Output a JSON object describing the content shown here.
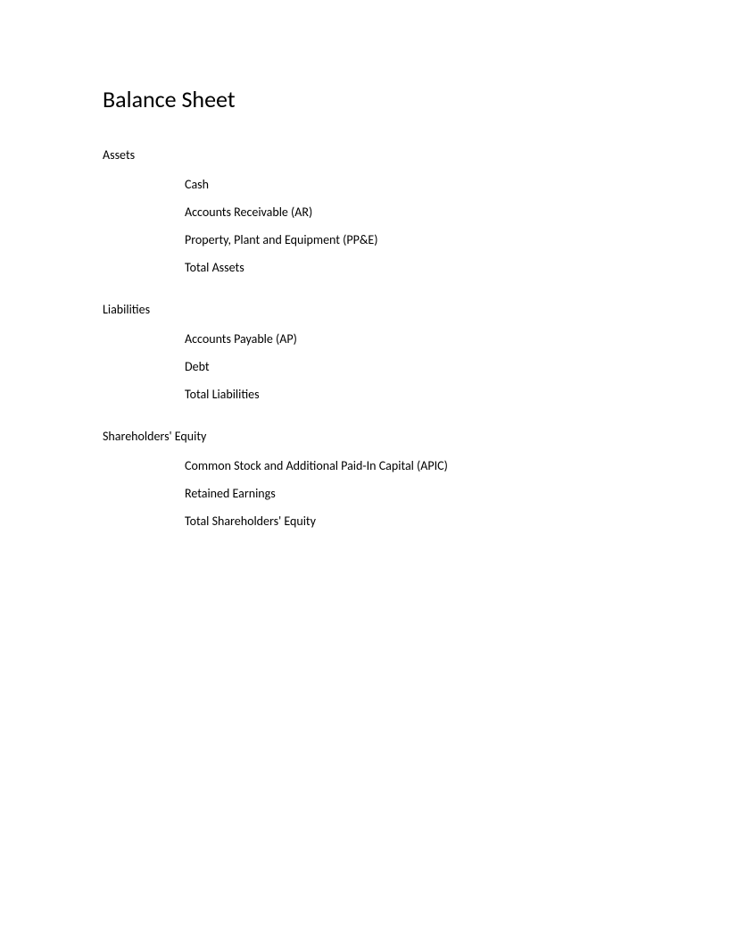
{
  "title": "Balance Sheet",
  "sections": {
    "assets": {
      "header": "Assets",
      "items": [
        "Cash",
        "Accounts Receivable (AR)",
        "Property, Plant and Equipment (PP&E)",
        "Total Assets"
      ]
    },
    "liabilities": {
      "header": "Liabilities",
      "items": [
        "Accounts Payable (AP)",
        "Debt",
        "Total Liabilities"
      ]
    },
    "equity": {
      "header": "Shareholders' Equity",
      "items": [
        "Common Stock and Additional Paid-In Capital (APIC)",
        "Retained Earnings",
        "Total Shareholders' Equity"
      ]
    }
  }
}
